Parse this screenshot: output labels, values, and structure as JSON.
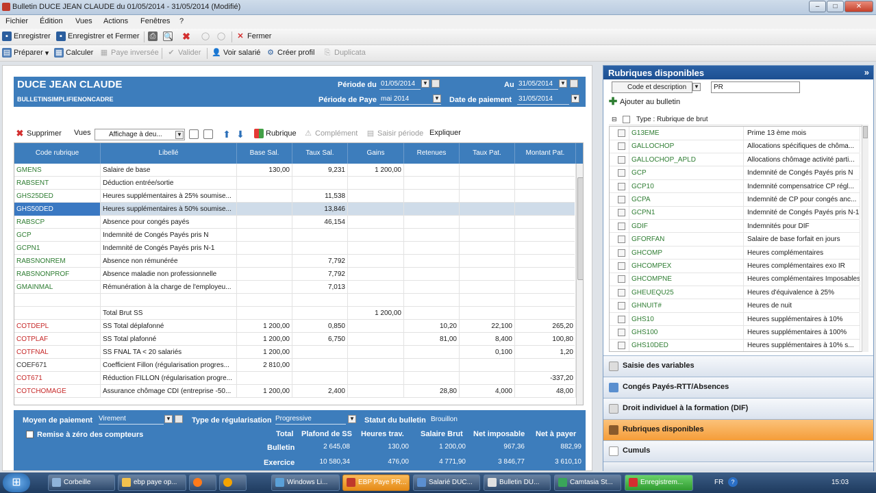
{
  "window": {
    "title": "Bulletin DUCE JEAN CLAUDE du 01/05/2014 - 31/05/2014 (Modifié)"
  },
  "menu": [
    "Fichier",
    "Édition",
    "Vues",
    "Actions",
    "Fenêtres",
    "?"
  ],
  "toolbar1": {
    "save": "Enregistrer",
    "save_close": "Enregistrer et Fermer",
    "close": "Fermer"
  },
  "toolbar2": {
    "prepare": "Préparer",
    "calculate": "Calculer",
    "reverse": "Paye inversée",
    "validate": "Valider",
    "employee": "Voir salarié",
    "profile": "Créer profil",
    "duplicate": "Duplicata"
  },
  "employee": {
    "name": "DUCE JEAN CLAUDE",
    "profile": "BULLETINSIMPLIFIENONCADRE"
  },
  "period": {
    "from_label": "Période du",
    "from": "01/05/2014",
    "to_label": "Au",
    "to": "31/05/2014",
    "pay_period_label": "Période de Paye",
    "pay_period": "mai 2014",
    "payment_date_label": "Date de paiement",
    "payment_date": "31/05/2014"
  },
  "grid_toolbar": {
    "delete": "Supprimer",
    "views": "Vues",
    "view_value": "Affichage à deu...",
    "rubrique": "Rubrique",
    "complement": "Complément",
    "saisir": "Saisir période",
    "explain": "Expliquer"
  },
  "grid": {
    "headers": [
      "Code rubrique",
      "Libellé",
      "Base Sal.",
      "Taux Sal.",
      "Gains",
      "Retenues",
      "Taux Pat.",
      "Montant Pat."
    ],
    "rows": [
      [
        "GMENS",
        "Salaire de base",
        "130,00",
        "9,231",
        "1 200,00",
        "",
        "",
        ""
      ],
      [
        "RABSENT",
        "Déduction entrée/sortie",
        "",
        "",
        "",
        "",
        "",
        ""
      ],
      [
        "GHS25DED",
        "Heures supplémentaires à 25% soumise...",
        "",
        "11,538",
        "",
        "",
        "",
        ""
      ],
      [
        "GHS50DED",
        "Heures supplémentaires à 50% soumise...",
        "",
        "13,846",
        "",
        "",
        "",
        ""
      ],
      [
        "RABSCP",
        "Absence pour congés payés",
        "",
        "46,154",
        "",
        "",
        "",
        ""
      ],
      [
        "GCP",
        "Indemnité de Congés Payés pris N",
        "",
        "",
        "",
        "",
        "",
        ""
      ],
      [
        "GCPN1",
        "Indemnité de Congés Payés pris N-1",
        "",
        "",
        "",
        "",
        "",
        ""
      ],
      [
        "RABSNONREM",
        "Absence non rémunérée",
        "",
        "7,792",
        "",
        "",
        "",
        ""
      ],
      [
        "RABSNONPROF",
        "Absence maladie non professionnelle",
        "",
        "7,792",
        "",
        "",
        "",
        ""
      ],
      [
        "GMAINMAL",
        "Rémunération à la charge de l'employeu...",
        "",
        "7,013",
        "",
        "",
        "",
        ""
      ],
      [
        "",
        "",
        "",
        "",
        "",
        "",
        "",
        ""
      ],
      [
        "",
        "Total Brut SS",
        "",
        "",
        "1 200,00",
        "",
        "",
        ""
      ],
      [
        "COTDEPL",
        "SS Total déplafonné",
        "1 200,00",
        "0,850",
        "",
        "10,20",
        "22,100",
        "265,20"
      ],
      [
        "COTPLAF",
        "SS Total plafonné",
        "1 200,00",
        "6,750",
        "",
        "81,00",
        "8,400",
        "100,80"
      ],
      [
        "COTFNAL",
        "SS FNAL TA < 20 salariés",
        "1 200,00",
        "",
        "",
        "",
        "0,100",
        "1,20"
      ],
      [
        "COEF671",
        "Coefficient Fillon (régularisation progres...",
        "2 810,00",
        "",
        "",
        "",
        "",
        ""
      ],
      [
        "COT671",
        "Réduction FILLON (régularisation progre...",
        "",
        "",
        "",
        "",
        "",
        "-337,20"
      ],
      [
        "COTCHOMAGE",
        "Assurance chômage CDI (entreprise -50...",
        "1 200,00",
        "2,400",
        "",
        "28,80",
        "4,000",
        "48,00"
      ]
    ],
    "code_colors": [
      "#2e7d32",
      "#2e7d32",
      "#2e7d32",
      "#ffffff",
      "#2e7d32",
      "#2e7d32",
      "#2e7d32",
      "#2e7d32",
      "#2e7d32",
      "#2e7d32",
      "#2e7d32",
      "#2e7d32",
      "#c62828",
      "#c62828",
      "#c62828",
      "#333333",
      "#c62828",
      "#c62828"
    ]
  },
  "footer": {
    "payment_method_label": "Moyen de paiement",
    "payment_method": "Virement",
    "regul_label": "Type de régularisation",
    "regul": "Progressive",
    "status_label": "Statut du bulletin",
    "status": "Brouillon",
    "reset_label": "Remise à zéro des compteurs",
    "cols": [
      "Total",
      "Plafond de SS",
      "Heures trav.",
      "Salaire Brut",
      "Net imposable",
      "Net à payer"
    ],
    "bulletin_label": "Bulletin",
    "bulletin": [
      "2 645,08",
      "130,00",
      "1 200,00",
      "967,36",
      "882,99"
    ],
    "exercice_label": "Exercice",
    "exercice": [
      "10 580,34",
      "476,00",
      "4 771,90",
      "3 846,77",
      "3 610,10"
    ]
  },
  "right": {
    "title": "Rubriques disponibles",
    "filter_mode": "Code et description",
    "search_value": "PR",
    "add_label": "Ajouter au bulletin",
    "group_label": "Type : Rubrique de brut",
    "items": [
      [
        "G13EME",
        "Prime 13 ème mois"
      ],
      [
        "GALLOCHOP",
        "Allocations spécifiques de chôma..."
      ],
      [
        "GALLOCHOP_APLD",
        "Allocations chômage activité parti..."
      ],
      [
        "GCP",
        "Indemnité de Congés Payés pris N"
      ],
      [
        "GCP10",
        "Indemnité compensatrice CP régl..."
      ],
      [
        "GCPA",
        "Indemnité de CP pour congés anc..."
      ],
      [
        "GCPN1",
        "Indemnité de Congés Payés pris N-1"
      ],
      [
        "GDIF",
        "Indemnités pour DIF"
      ],
      [
        "GFORFAN",
        "Salaire de base forfait en jours"
      ],
      [
        "GHCOMP",
        "Heures complémentaires"
      ],
      [
        "GHCOMPEX",
        "Heures complémentaires exo IR"
      ],
      [
        "GHCOMPNE",
        "Heures complémentaires Imposables"
      ],
      [
        "GHEUEQU25",
        "Heures d'équivalence à 25%"
      ],
      [
        "GHNUIT#",
        "Heures de nuit"
      ],
      [
        "GHS10",
        "Heures supplémentaires à 10%"
      ],
      [
        "GHS100",
        "Heures supplémentaires à 100%"
      ],
      [
        "GHS10DED",
        "Heures supplémentaires à 10% s..."
      ]
    ],
    "sections": [
      "Saisie des variables",
      "Congés Payés-RTT/Absences",
      "Droit individuel à la formation (DIF)",
      "Rubriques disponibles",
      "Cumuls"
    ]
  },
  "taskbar": {
    "items": [
      "Corbeille",
      "ebp paye op...",
      "",
      "",
      "Windows Li...",
      "EBP Paye PR...",
      "Salarié DUC...",
      "Bulletin DU...",
      "Camtasia St...",
      "Enregistrem..."
    ],
    "lang": "FR",
    "clock": "15:03"
  }
}
